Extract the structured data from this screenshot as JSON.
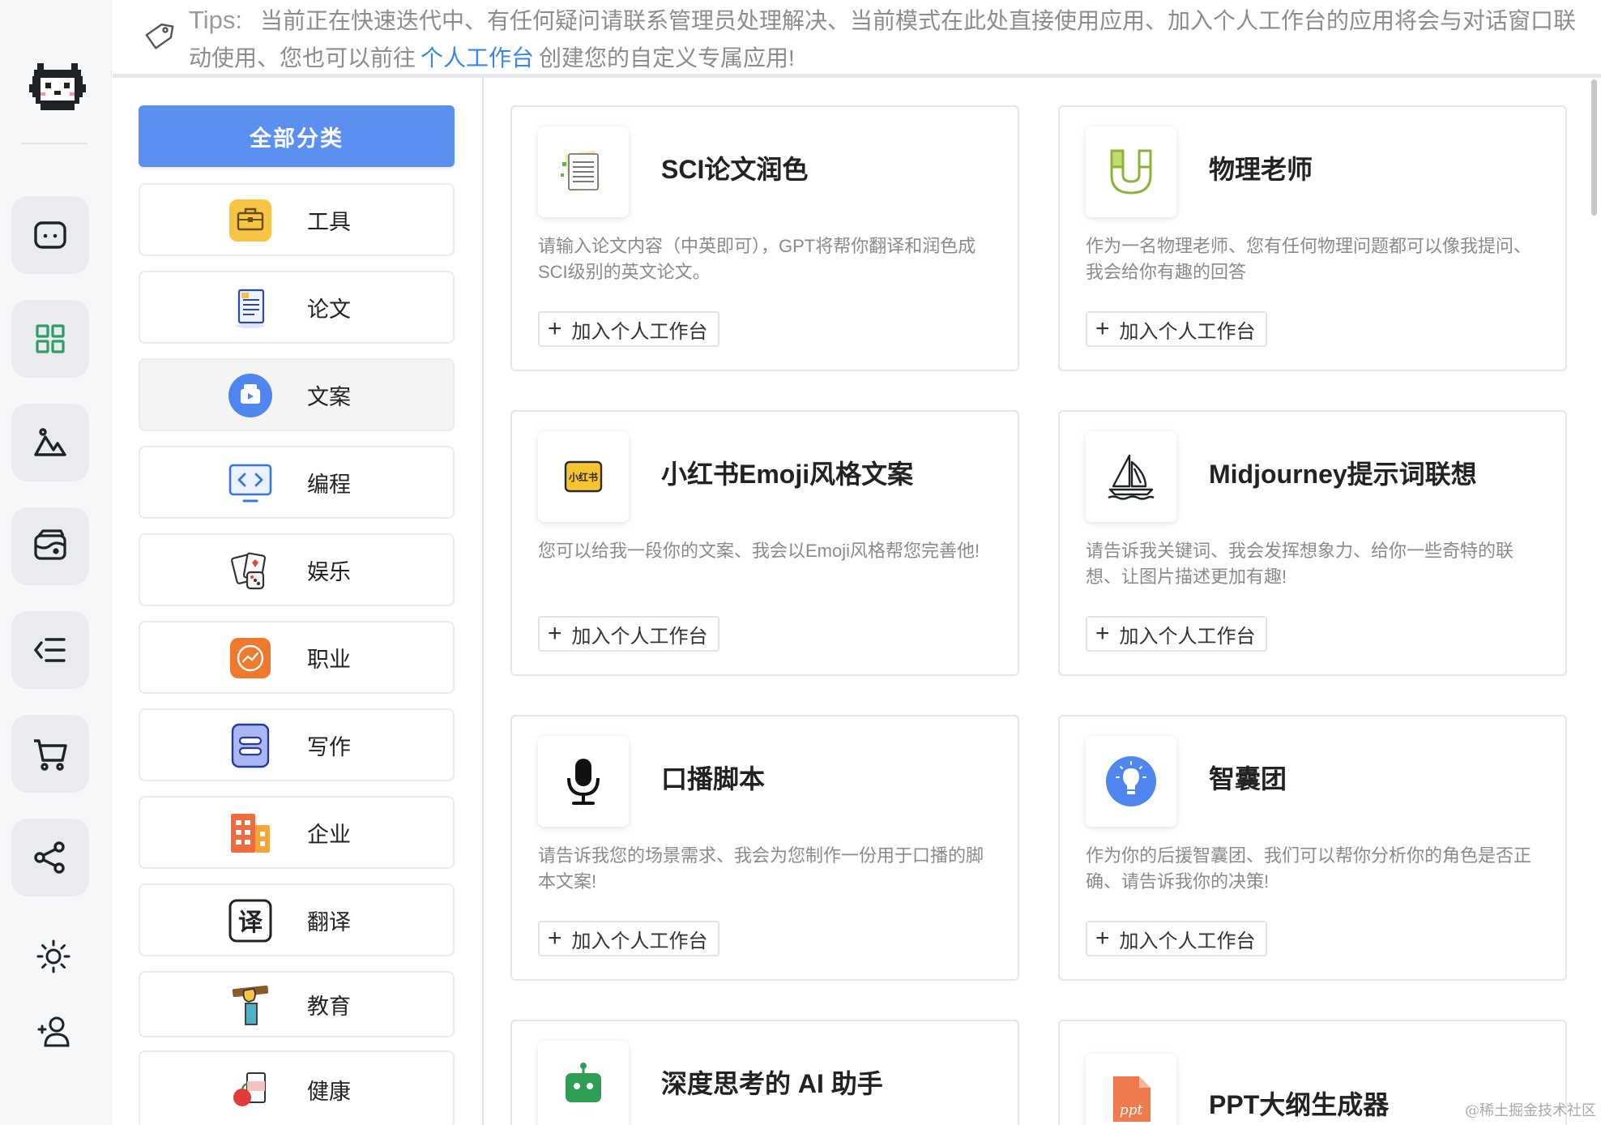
{
  "tips": {
    "label": "Tips:",
    "text_before": "当前正在快速迭代中、有任何疑问请联系管理员处理解决、当前模式在此处直接使用应用、加入个人工作台的应用将会与对话窗口联动使用、您也可以前往",
    "link": "个人工作台",
    "text_after": "创建您的自定义专属应用!"
  },
  "sidebar": {
    "icons": [
      "cat-logo-icon",
      "chat-icon",
      "apps-grid-icon",
      "image-icon",
      "wallet-icon",
      "list-indent-icon",
      "cart-icon",
      "share-icon",
      "sun-icon",
      "user-add-icon"
    ]
  },
  "categories": {
    "all_label": "全部分类",
    "items": [
      {
        "label": "工具",
        "icon": "toolbox-icon"
      },
      {
        "label": "论文",
        "icon": "document-icon"
      },
      {
        "label": "文案",
        "icon": "copywriting-icon"
      },
      {
        "label": "编程",
        "icon": "code-icon"
      },
      {
        "label": "娱乐",
        "icon": "dice-cards-icon"
      },
      {
        "label": "职业",
        "icon": "career-icon"
      },
      {
        "label": "写作",
        "icon": "writing-icon"
      },
      {
        "label": "企业",
        "icon": "enterprise-icon"
      },
      {
        "label": "翻译",
        "icon": "translate-icon"
      },
      {
        "label": "教育",
        "icon": "education-icon"
      },
      {
        "label": "健康",
        "icon": "health-icon"
      }
    ]
  },
  "apps": [
    {
      "title": "SCI论文润色",
      "desc": "请输入论文内容（中英即可），GPT将帮你翻译和润色成SCI级别的英文论文。",
      "add": "加入个人工作台",
      "icon": "paper-notes-icon"
    },
    {
      "title": "物理老师",
      "desc": "作为一名物理老师、您有任何物理问题都可以像我提问、我会给你有趣的回答",
      "add": "加入个人工作台",
      "icon": "magnet-icon"
    },
    {
      "title": "小红书Emoji风格文案",
      "desc": "您可以给我一段你的文案、我会以Emoji风格帮您完善他!",
      "add": "加入个人工作台",
      "icon": "xiaohongshu-icon",
      "icon_text": "小红书"
    },
    {
      "title": "Midjourney提示词联想",
      "desc": "请告诉我关键词、我会发挥想象力、给你一些奇特的联想、让图片描述更加有趣!",
      "add": "加入个人工作台",
      "icon": "sailboat-icon"
    },
    {
      "title": "口播脚本",
      "desc": "请告诉我您的场景需求、我会为您制作一份用于口播的脚本文案!",
      "add": "加入个人工作台",
      "icon": "microphone-icon"
    },
    {
      "title": "智囊团",
      "desc": "作为你的后援智囊团、我们可以帮你分析你的角色是否正确、请告诉我你的决策!",
      "add": "加入个人工作台",
      "icon": "lightbulb-icon"
    },
    {
      "title": "深度思考的 AI 助手",
      "desc": "",
      "add": "",
      "icon": "robot-icon"
    },
    {
      "title": "PPT大纲生成器",
      "desc": "",
      "add": "",
      "icon": "ppt-file-icon",
      "icon_text": "ppt"
    }
  ],
  "watermark": "@稀土掘金技术社区"
}
